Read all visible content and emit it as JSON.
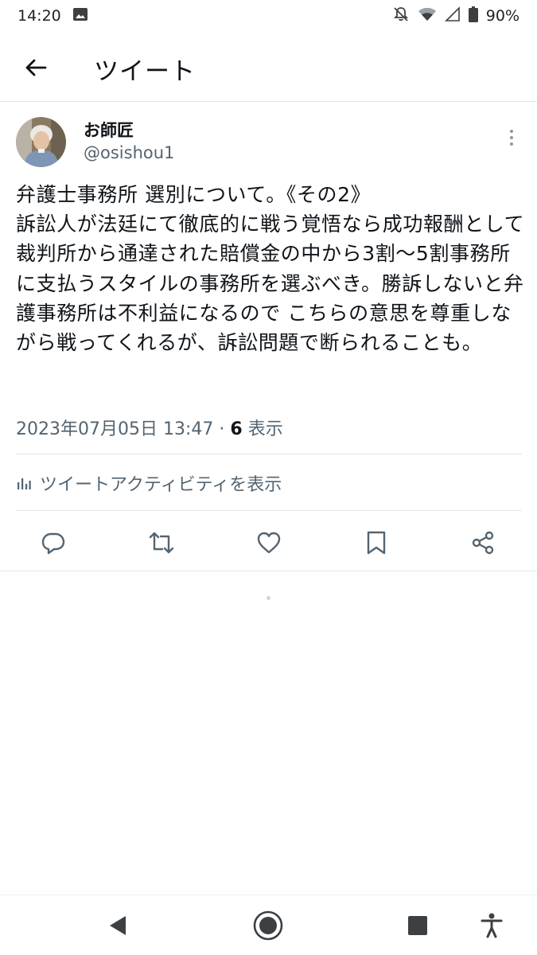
{
  "status_bar": {
    "time": "14:20",
    "battery": "90%",
    "icons": [
      "image-icon",
      "mute-icon",
      "wifi-icon",
      "signal-icon",
      "battery-icon"
    ]
  },
  "header": {
    "title": "ツイート",
    "back_icon": "arrow-left-icon"
  },
  "tweet": {
    "author": {
      "display_name": "お師匠",
      "handle": "@osishou1"
    },
    "text": "弁護士事務所 選別について。《その2》\n訴訟人が法廷にて徹底的に戦う覚悟なら成功報酬として裁判所から通達された賠償金の中から3割〜5割事務所に支払うスタイルの事務所を選ぶべき。勝訴しないと弁護事務所は不利益になるので こちらの意思を尊重しながら戦ってくれるが、訴訟問題で断られることも。",
    "datetime": "2023年07月05日 13:47",
    "separator": "·",
    "views_count": "6",
    "views_label": "表示",
    "activity_label": "ツイートアクティビティを表示"
  },
  "actions": [
    "reply-icon",
    "retweet-icon",
    "like-icon",
    "bookmark-icon",
    "share-icon"
  ],
  "nav": [
    "back-triangle-icon",
    "home-circle-icon",
    "recents-square-icon",
    "accessibility-icon"
  ],
  "colors": {
    "text_primary": "#0f1419",
    "text_secondary": "#536471",
    "divider": "#e6e6e6"
  }
}
